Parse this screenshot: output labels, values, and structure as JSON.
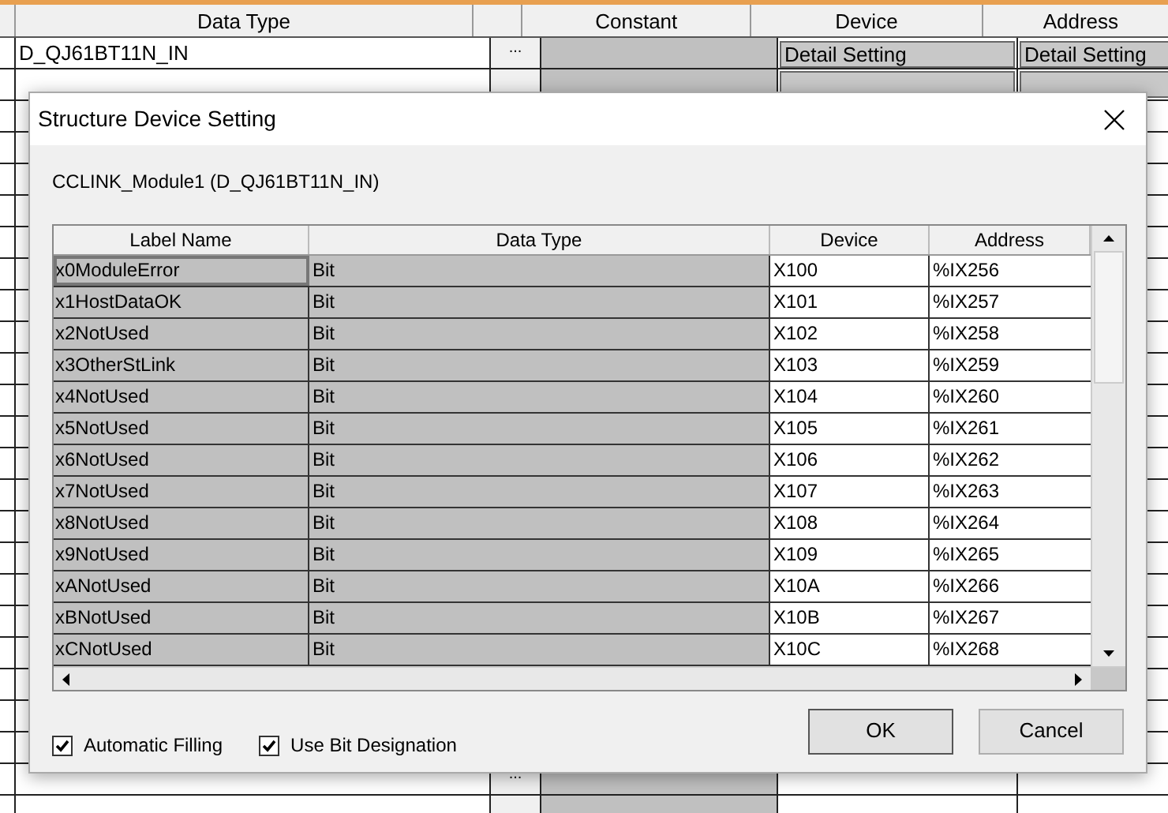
{
  "background_table": {
    "columns": [
      "Data Type",
      "Constant",
      "Device",
      "Address"
    ],
    "rows": [
      {
        "kind": "detail",
        "data_type": "D_QJ61BT11N_IN",
        "button": "...",
        "device": "Detail Setting",
        "address": "Detail Setting"
      },
      {
        "kind": "detail"
      },
      {
        "kind": "plain"
      },
      {
        "kind": "plain"
      },
      {
        "kind": "plain"
      },
      {
        "kind": "plain"
      },
      {
        "kind": "plain"
      },
      {
        "kind": "plain"
      },
      {
        "kind": "plain"
      },
      {
        "kind": "plain"
      },
      {
        "kind": "plain"
      },
      {
        "kind": "plain"
      },
      {
        "kind": "plain"
      },
      {
        "kind": "plain"
      },
      {
        "kind": "plain"
      },
      {
        "kind": "plain"
      },
      {
        "kind": "plain"
      },
      {
        "kind": "plain"
      },
      {
        "kind": "plain"
      },
      {
        "kind": "plain"
      },
      {
        "kind": "plain"
      },
      {
        "kind": "plain"
      },
      {
        "kind": "plain"
      },
      {
        "kind": "plain",
        "button": "..."
      },
      {
        "kind": "plain"
      }
    ]
  },
  "dialog": {
    "title": "Structure Device Setting",
    "subtitle": "CCLINK_Module1 (D_QJ61BT11N_IN)",
    "columns": [
      "Label Name",
      "Data Type",
      "Device",
      "Address"
    ],
    "rows": [
      {
        "label": "x0ModuleError",
        "data_type": "Bit",
        "device": "X100",
        "address": "%IX256",
        "selected": true
      },
      {
        "label": "x1HostDataOK",
        "data_type": "Bit",
        "device": "X101",
        "address": "%IX257",
        "selected": false
      },
      {
        "label": "x2NotUsed",
        "data_type": "Bit",
        "device": "X102",
        "address": "%IX258",
        "selected": false
      },
      {
        "label": "x3OtherStLink",
        "data_type": "Bit",
        "device": "X103",
        "address": "%IX259",
        "selected": false
      },
      {
        "label": "x4NotUsed",
        "data_type": "Bit",
        "device": "X104",
        "address": "%IX260",
        "selected": false
      },
      {
        "label": "x5NotUsed",
        "data_type": "Bit",
        "device": "X105",
        "address": "%IX261",
        "selected": false
      },
      {
        "label": "x6NotUsed",
        "data_type": "Bit",
        "device": "X106",
        "address": "%IX262",
        "selected": false
      },
      {
        "label": "x7NotUsed",
        "data_type": "Bit",
        "device": "X107",
        "address": "%IX263",
        "selected": false
      },
      {
        "label": "x8NotUsed",
        "data_type": "Bit",
        "device": "X108",
        "address": "%IX264",
        "selected": false
      },
      {
        "label": "x9NotUsed",
        "data_type": "Bit",
        "device": "X109",
        "address": "%IX265",
        "selected": false
      },
      {
        "label": "xANotUsed",
        "data_type": "Bit",
        "device": "X10A",
        "address": "%IX266",
        "selected": false
      },
      {
        "label": "xBNotUsed",
        "data_type": "Bit",
        "device": "X10B",
        "address": "%IX267",
        "selected": false
      },
      {
        "label": "xCNotUsed",
        "data_type": "Bit",
        "device": "X10C",
        "address": "%IX268",
        "selected": false
      }
    ],
    "checkboxes": [
      {
        "label": "Automatic Filling",
        "checked": true
      },
      {
        "label": "Use Bit Designation",
        "checked": true
      }
    ],
    "buttons": [
      "OK",
      "Cancel"
    ]
  }
}
